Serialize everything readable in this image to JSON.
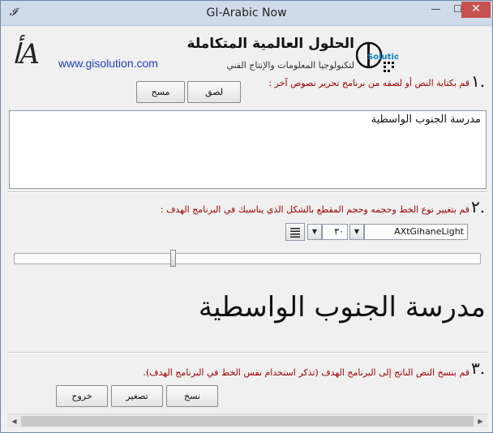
{
  "window": {
    "title": "GI-Arabic Now",
    "minimize_glyph": "—",
    "maximize_glyph": "☐",
    "close_glyph": "✕"
  },
  "header": {
    "website": "www.gisolution.com",
    "company_name": "الحلول العالمية المتكاملة",
    "company_tagline": "لتكنولوجيا المعلومات والإنتاج الفني",
    "logo_text": "Solution"
  },
  "step1": {
    "number": "١.",
    "instruction": "قم بكتابة النص أو لصقه من برنامج تحرير نصوص آخر :",
    "paste_label": "لصق",
    "clear_label": "مسح",
    "input_text": "مدرسة الجنوب الواسطية"
  },
  "step2": {
    "number": "٢.",
    "instruction": "قم بتغيير نوع الخط وحجمه وحجم المقطع بالشكل الذي يناسبك في البرنامج الهدف :",
    "font_name": "AXtGihaneLight",
    "font_size": "٣٠"
  },
  "preview": {
    "text": "مدرسة الجنوب الواسطية"
  },
  "step3": {
    "number": "٣.",
    "instruction": "قم بنسخ النص الناتج إلى البرنامج الهدف (تذكر استخدام نفس الخط في البرنامج الهدف).",
    "copy_label": "نسخ",
    "shrink_label": "تصغير",
    "exit_label": "خروج"
  },
  "slider": {
    "value": 0.34
  },
  "colors": {
    "instruction_red": "#a00000",
    "link_blue": "#1a3fbf",
    "close_red": "#c75050"
  }
}
